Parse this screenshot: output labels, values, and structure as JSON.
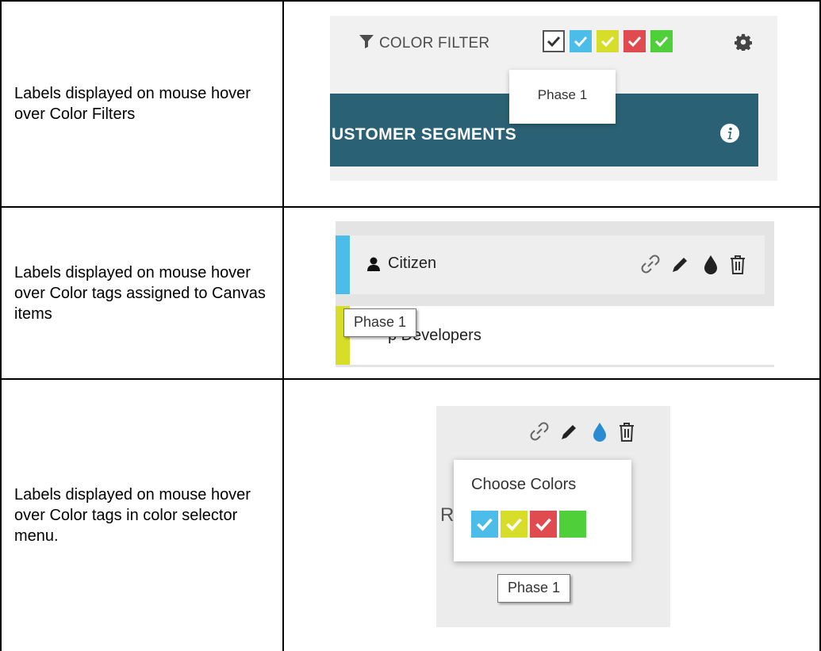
{
  "rows": [
    {
      "description": "Labels displayed on mouse hover over Color Filters",
      "shot": {
        "filter_label": "COLOR FILTER",
        "tooltip": "Phase 1",
        "segment_title": "USTOMER SEGMENTS",
        "filter_swatches": [
          {
            "name": "all",
            "color": "#ffffff",
            "checked": true
          },
          {
            "name": "blue",
            "color": "#4bbde8",
            "checked": true
          },
          {
            "name": "yellow",
            "color": "#d7de2a",
            "checked": true
          },
          {
            "name": "red",
            "color": "#df4b4f",
            "checked": true
          },
          {
            "name": "green",
            "color": "#4fcf3a",
            "checked": true
          }
        ],
        "icons": [
          "filter-icon",
          "gear-icon",
          "info-icon"
        ]
      }
    },
    {
      "description": "Labels displayed on mouse hover over Color tags assigned to Canvas items",
      "shot": {
        "item_1_label": "Citizen",
        "item_1_tag_color": "#4bbde8",
        "item_2_label": "p Developers",
        "item_2_tag_color": "#d7de2a",
        "tooltip": "Phase 1",
        "icons": [
          "user-icon",
          "link-icon",
          "pencil-icon",
          "drop-icon",
          "trash-icon"
        ]
      }
    },
    {
      "description": "Labels displayed on mouse hover over Color tags in color selector menu.",
      "shot": {
        "menu_title": "Choose Colors",
        "partial_text": "R",
        "tooltip": "Phase 1",
        "swatches": [
          {
            "name": "blue",
            "color": "#4bbde8",
            "checked": true
          },
          {
            "name": "yellow",
            "color": "#d7de2a",
            "checked": true
          },
          {
            "name": "red",
            "color": "#df4b4f",
            "checked": true
          },
          {
            "name": "green",
            "color": "#4fcf3a",
            "checked": false
          }
        ],
        "icons": [
          "link-icon",
          "pencil-icon",
          "drop-icon",
          "trash-icon"
        ]
      }
    }
  ]
}
